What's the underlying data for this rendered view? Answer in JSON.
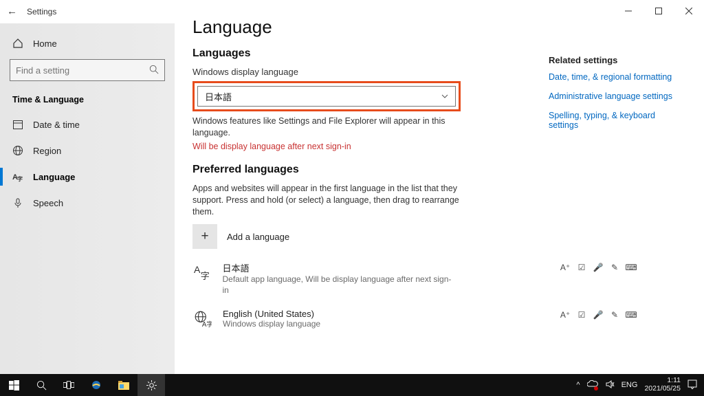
{
  "header": {
    "app_name": "Settings"
  },
  "sidebar": {
    "home_label": "Home",
    "search_placeholder": "Find a setting",
    "section_title": "Time & Language",
    "items": [
      {
        "label": "Date & time"
      },
      {
        "label": "Region"
      },
      {
        "label": "Language"
      },
      {
        "label": "Speech"
      }
    ]
  },
  "main": {
    "title": "Language",
    "sec_languages": "Languages",
    "display_label": "Windows display language",
    "display_selected": "日本語",
    "display_helper": "Windows features like Settings and File Explorer will appear in this language.",
    "display_warn": "Will be display language after next sign-in",
    "sec_preferred": "Preferred languages",
    "preferred_helper": "Apps and websites will appear in the first language in the list that they support. Press and hold (or select) a language, then drag to rearrange them.",
    "add_label": "Add a language",
    "langs": [
      {
        "name": "日本語",
        "sub": "Default app language, Will be display language after next sign-in"
      },
      {
        "name": "English (United States)",
        "sub": "Windows display language"
      }
    ]
  },
  "related": {
    "title": "Related settings",
    "links": [
      "Date, time, & regional formatting",
      "Administrative language settings",
      "Spelling, typing, & keyboard settings"
    ]
  },
  "taskbar": {
    "lang": "ENG",
    "time": "1:11",
    "date": "2021/05/25"
  }
}
